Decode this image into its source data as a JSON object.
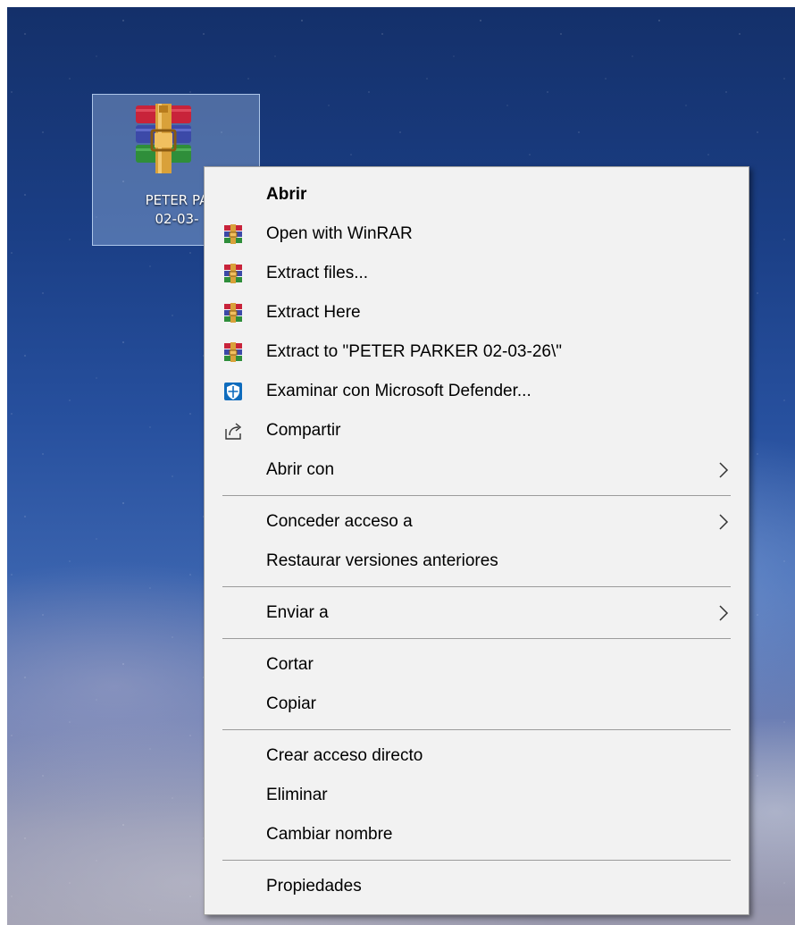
{
  "desktop": {
    "icon": {
      "name_line1": "PETER PA",
      "name_line2": "02-03-",
      "icon": "winrar-archive-icon"
    }
  },
  "context_menu": {
    "groups": [
      [
        {
          "label": "Abrir",
          "bold": true,
          "icon": null,
          "submenu": false
        },
        {
          "label": "Open with WinRAR",
          "icon": "winrar-icon",
          "submenu": false
        },
        {
          "label": "Extract files...",
          "icon": "winrar-icon",
          "submenu": false
        },
        {
          "label": "Extract Here",
          "icon": "winrar-icon",
          "submenu": false
        },
        {
          "label": "Extract to \"PETER PARKER 02-03-26\\\"",
          "icon": "winrar-icon",
          "submenu": false
        },
        {
          "label": "Examinar con Microsoft Defender...",
          "icon": "defender-shield-icon",
          "submenu": false
        },
        {
          "label": "Compartir",
          "icon": "share-icon",
          "submenu": false
        },
        {
          "label": "Abrir con",
          "icon": null,
          "submenu": true
        }
      ],
      [
        {
          "label": "Conceder acceso a",
          "icon": null,
          "submenu": true
        },
        {
          "label": "Restaurar versiones anteriores",
          "icon": null,
          "submenu": false
        }
      ],
      [
        {
          "label": "Enviar a",
          "icon": null,
          "submenu": true
        }
      ],
      [
        {
          "label": "Cortar",
          "icon": null,
          "submenu": false
        },
        {
          "label": "Copiar",
          "icon": null,
          "submenu": false
        }
      ],
      [
        {
          "label": "Crear acceso directo",
          "icon": null,
          "submenu": false
        },
        {
          "label": "Eliminar",
          "icon": null,
          "submenu": false
        },
        {
          "label": "Cambiar nombre",
          "icon": null,
          "submenu": false
        }
      ],
      [
        {
          "label": "Propiedades",
          "icon": null,
          "submenu": false
        }
      ]
    ]
  },
  "colors": {
    "menu_background": "#f2f2f2",
    "separator": "#9b9b9b",
    "defender_blue": "#0f6cbd",
    "selection_highlight": "#b4d2f5"
  }
}
